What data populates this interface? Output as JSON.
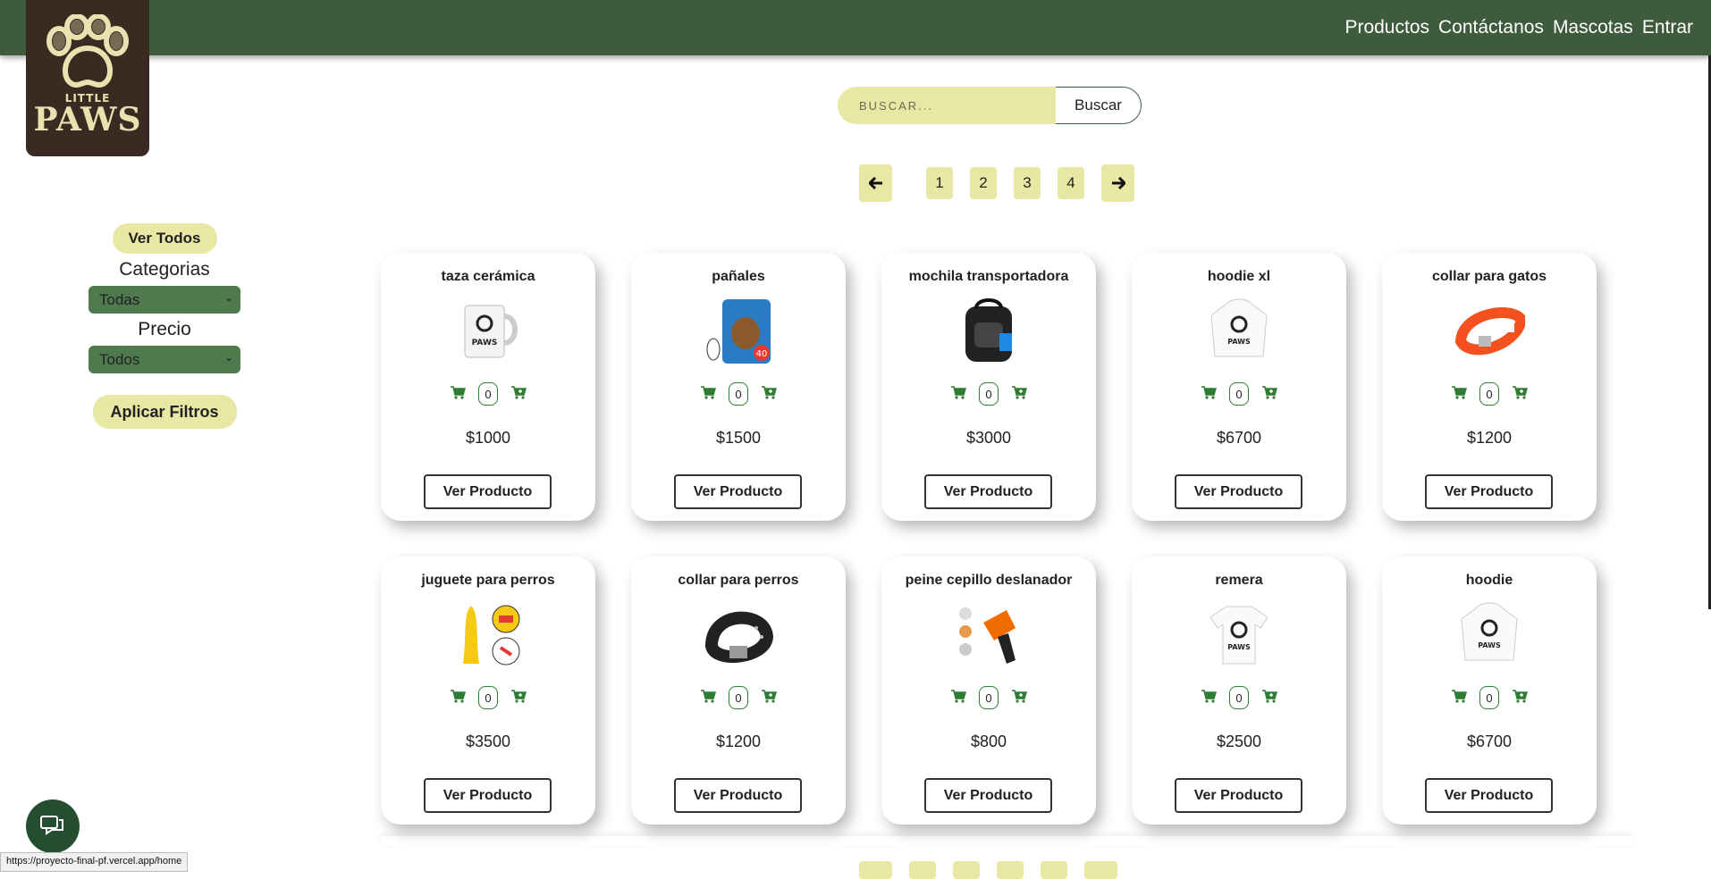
{
  "nav": {
    "items": [
      "Productos",
      "Contáctanos",
      "Mascotas",
      "Entrar"
    ]
  },
  "logo": {
    "line1": "LITTLE",
    "line2": "PAWS"
  },
  "search": {
    "placeholder": "BUSCAR...",
    "button_label": "Buscar"
  },
  "pagination": {
    "prev_icon": "arrow-left-icon",
    "pages": [
      "1",
      "2",
      "3",
      "4"
    ],
    "next_icon": "arrow-right-icon"
  },
  "sidebar": {
    "ver_todos": "Ver Todos",
    "categorias_label": "Categorias",
    "categorias_value": "Todas",
    "precio_label": "Precio",
    "precio_value": "Todos",
    "aplicar": "Aplicar Filtros"
  },
  "products": [
    {
      "name": "taza cerámica",
      "qty": "0",
      "price": "$1000",
      "button": "Ver Producto",
      "image": "mug"
    },
    {
      "name": "pañales",
      "qty": "0",
      "price": "$1500",
      "button": "Ver Producto",
      "image": "diapers"
    },
    {
      "name": "mochila transportadora",
      "qty": "0",
      "price": "$3000",
      "button": "Ver Producto",
      "image": "backpack"
    },
    {
      "name": "hoodie xl",
      "qty": "0",
      "price": "$6700",
      "button": "Ver Producto",
      "image": "hoodie"
    },
    {
      "name": "collar para gatos",
      "qty": "0",
      "price": "$1200",
      "button": "Ver Producto",
      "image": "cat-collar"
    },
    {
      "name": "juguete para perros",
      "qty": "0",
      "price": "$3500",
      "button": "Ver Producto",
      "image": "chicken-toy"
    },
    {
      "name": "collar para perros",
      "qty": "0",
      "price": "$1200",
      "button": "Ver Producto",
      "image": "dog-collar"
    },
    {
      "name": "peine cepillo deslanador",
      "qty": "0",
      "price": "$800",
      "button": "Ver Producto",
      "image": "brush"
    },
    {
      "name": "remera",
      "qty": "0",
      "price": "$2500",
      "button": "Ver Producto",
      "image": "tshirt"
    },
    {
      "name": "hoodie",
      "qty": "0",
      "price": "$6700",
      "button": "Ver Producto",
      "image": "hoodie"
    }
  ],
  "status_url": "https://proyecto-final-pf.vercel.app/home",
  "colors": {
    "topbar": "#3e5b3e",
    "accent": "#e8e8a4",
    "cart_icon": "#2e7d32",
    "logo_bg": "#3b2a22"
  }
}
